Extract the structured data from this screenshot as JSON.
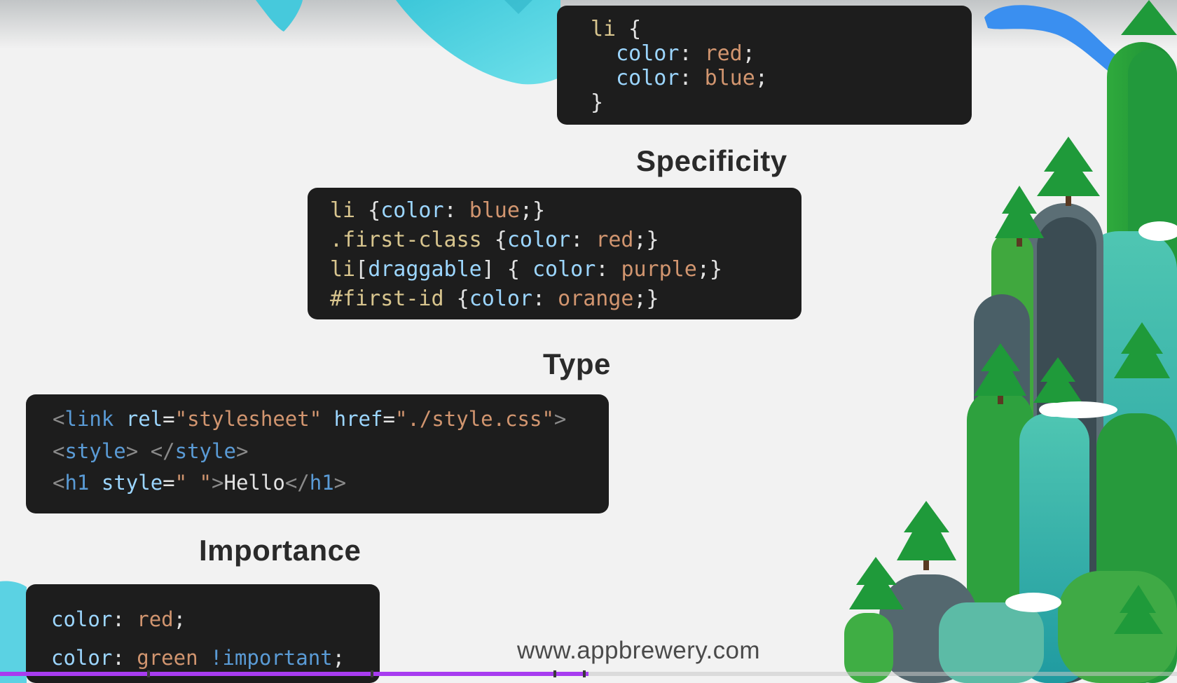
{
  "slide": {
    "colors": {
      "code_bg": "#1d1d1d",
      "heading": "#2a2a2a",
      "progress": "#a83cf0",
      "selector": "#d8c58e",
      "property": "#9cd6ff",
      "value": "#d1956f",
      "tag": "#5a9bd6"
    },
    "cascade_block": {
      "lines": [
        [
          {
            "t": "li",
            "c": "sel"
          },
          {
            "t": " {",
            "c": "punc"
          }
        ],
        [
          {
            "t": "  ",
            "c": "punc"
          },
          {
            "t": "color",
            "c": "prop"
          },
          {
            "t": ": ",
            "c": "punc"
          },
          {
            "t": "red",
            "c": "val"
          },
          {
            "t": ";",
            "c": "punc"
          }
        ],
        [
          {
            "t": "  ",
            "c": "punc"
          },
          {
            "t": "color",
            "c": "prop"
          },
          {
            "t": ": ",
            "c": "punc"
          },
          {
            "t": "blue",
            "c": "val"
          },
          {
            "t": ";",
            "c": "punc"
          }
        ],
        [
          {
            "t": "}",
            "c": "punc"
          }
        ]
      ]
    },
    "specificity": {
      "heading": "Specificity",
      "lines": [
        [
          {
            "t": "li",
            "c": "sel"
          },
          {
            "t": " {",
            "c": "punc"
          },
          {
            "t": "color",
            "c": "prop"
          },
          {
            "t": ": ",
            "c": "punc"
          },
          {
            "t": "blue",
            "c": "val"
          },
          {
            "t": ";}",
            "c": "punc"
          }
        ],
        [
          {
            "t": ".first-class",
            "c": "sel"
          },
          {
            "t": " {",
            "c": "punc"
          },
          {
            "t": "color",
            "c": "prop"
          },
          {
            "t": ": ",
            "c": "punc"
          },
          {
            "t": "red",
            "c": "val"
          },
          {
            "t": ";}",
            "c": "punc"
          }
        ],
        [
          {
            "t": "li",
            "c": "sel"
          },
          {
            "t": "[",
            "c": "punc"
          },
          {
            "t": "draggable",
            "c": "prop"
          },
          {
            "t": "]",
            "c": "punc"
          },
          {
            "t": " { ",
            "c": "punc"
          },
          {
            "t": "color",
            "c": "prop"
          },
          {
            "t": ": ",
            "c": "punc"
          },
          {
            "t": "purple",
            "c": "val"
          },
          {
            "t": ";}",
            "c": "punc"
          }
        ],
        [
          {
            "t": "#first-id",
            "c": "sel"
          },
          {
            "t": " {",
            "c": "punc"
          },
          {
            "t": "color",
            "c": "prop"
          },
          {
            "t": ": ",
            "c": "punc"
          },
          {
            "t": "orange",
            "c": "val"
          },
          {
            "t": ";}",
            "c": "punc"
          }
        ]
      ]
    },
    "type": {
      "heading": "Type",
      "lines": [
        [
          {
            "t": "<",
            "c": "tagbr"
          },
          {
            "t": "link",
            "c": "tag"
          },
          {
            "t": " ",
            "c": "text"
          },
          {
            "t": "rel",
            "c": "attr"
          },
          {
            "t": "=",
            "c": "text"
          },
          {
            "t": "\"stylesheet\"",
            "c": "str"
          },
          {
            "t": " ",
            "c": "text"
          },
          {
            "t": "href",
            "c": "attr"
          },
          {
            "t": "=",
            "c": "text"
          },
          {
            "t": "\"./style.css\"",
            "c": "str"
          },
          {
            "t": ">",
            "c": "tagbr"
          }
        ],
        [
          {
            "t": "<",
            "c": "tagbr"
          },
          {
            "t": "style",
            "c": "tag"
          },
          {
            "t": ">",
            "c": "tagbr"
          },
          {
            "t": " ",
            "c": "text"
          },
          {
            "t": "</",
            "c": "tagbr"
          },
          {
            "t": "style",
            "c": "tag"
          },
          {
            "t": ">",
            "c": "tagbr"
          }
        ],
        [
          {
            "t": "<",
            "c": "tagbr"
          },
          {
            "t": "h1",
            "c": "tag"
          },
          {
            "t": " ",
            "c": "text"
          },
          {
            "t": "style",
            "c": "attr"
          },
          {
            "t": "=",
            "c": "text"
          },
          {
            "t": "\" \"",
            "c": "str"
          },
          {
            "t": ">",
            "c": "tagbr"
          },
          {
            "t": "Hello",
            "c": "text"
          },
          {
            "t": "</",
            "c": "tagbr"
          },
          {
            "t": "h1",
            "c": "tag"
          },
          {
            "t": ">",
            "c": "tagbr"
          }
        ]
      ]
    },
    "importance": {
      "heading": "Importance",
      "lines": [
        [
          {
            "t": "color",
            "c": "prop"
          },
          {
            "t": ": ",
            "c": "punc"
          },
          {
            "t": "red",
            "c": "val"
          },
          {
            "t": ";",
            "c": "punc"
          }
        ],
        [
          {
            "t": "color",
            "c": "prop"
          },
          {
            "t": ": ",
            "c": "punc"
          },
          {
            "t": "green",
            "c": "val"
          },
          {
            "t": " ",
            "c": "punc"
          },
          {
            "t": "!important",
            "c": "imp"
          },
          {
            "t": ";",
            "c": "punc"
          }
        ]
      ]
    },
    "footer": {
      "url": "www.appbrewery.com"
    },
    "video_progress": {
      "played_fraction": 0.5,
      "chapter_marks": [
        0.125,
        0.315,
        0.47,
        0.495
      ]
    }
  }
}
